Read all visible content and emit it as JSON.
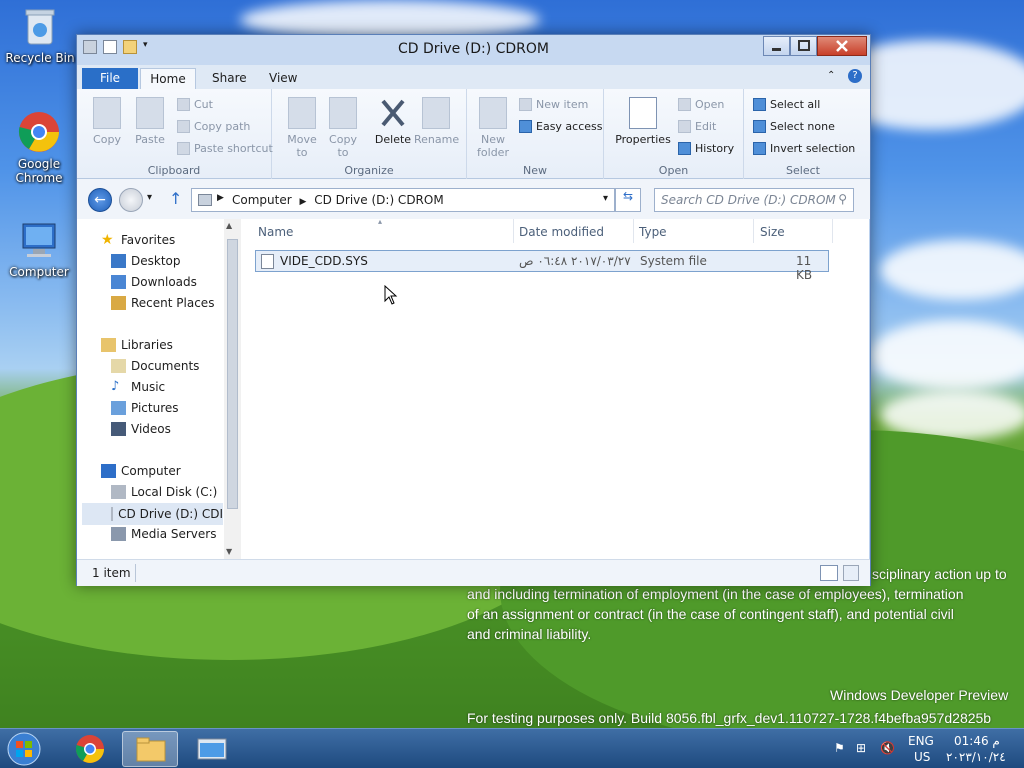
{
  "desktop": {
    "icons": [
      {
        "label": "Recycle Bin",
        "icon": "recycle-bin-icon"
      },
      {
        "label": "Google Chrome",
        "icon": "chrome-icon"
      },
      {
        "label": "Computer",
        "icon": "computer-icon"
      }
    ],
    "watermark": {
      "line1": "sciplinary action up to",
      "line2": "and including termination of employment (in the case of employees), termination",
      "line3": "of an assignment or contract (in the case of contingent staff), and potential civil",
      "line4": "and criminal liability.",
      "build_title": "Windows Developer Preview",
      "build_text": "For testing purposes only. Build 8056.fbl_grfx_dev1.110727-1728.f4befba957d2825b"
    }
  },
  "window": {
    "title": "CD Drive (D:) CDROM",
    "tabs": {
      "file": "File",
      "home": "Home",
      "share": "Share",
      "view": "View"
    },
    "ribbon": {
      "clipboard": {
        "copy": "Copy",
        "paste": "Paste",
        "cut": "Cut",
        "copy_path": "Copy path",
        "paste_shortcut": "Paste shortcut",
        "label": "Clipboard"
      },
      "organize": {
        "move_to": "Move to",
        "copy_to": "Copy to",
        "delete": "Delete",
        "rename": "Rename",
        "label": "Organize"
      },
      "new": {
        "new_folder": "New folder",
        "new_item": "New item",
        "easy_access": "Easy access",
        "label": "New"
      },
      "open": {
        "properties": "Properties",
        "open": "Open",
        "edit": "Edit",
        "history": "History",
        "label": "Open"
      },
      "select": {
        "select_all": "Select all",
        "select_none": "Select none",
        "invert_selection": "Invert selection",
        "label": "Select"
      }
    },
    "address": {
      "crumb1": "Computer",
      "crumb2": "CD Drive (D:) CDROM",
      "search_placeholder": "Search CD Drive (D:) CDROM"
    },
    "nav": {
      "favorites": "Favorites",
      "desktop": "Desktop",
      "downloads": "Downloads",
      "recent": "Recent Places",
      "libraries": "Libraries",
      "documents": "Documents",
      "music": "Music",
      "pictures": "Pictures",
      "videos": "Videos",
      "computer": "Computer",
      "local_disk": "Local Disk (C:)",
      "cd_drive": "CD Drive (D:) CDI",
      "media_servers": "Media Servers"
    },
    "columns": {
      "name": "Name",
      "date": "Date modified",
      "type": "Type",
      "size": "Size"
    },
    "files": [
      {
        "name": "VIDE_CDD.SYS",
        "date": "٢٠١٧/٠٣/٢٧ ٠٦:٤٨ ص",
        "type": "System file",
        "size": "11 KB"
      }
    ],
    "status": {
      "count": "1 item"
    }
  },
  "taskbar": {
    "lang": "ENG",
    "region": "US",
    "time": "01:46 م",
    "date": "٢٠٢٣/١٠/٢٤"
  }
}
